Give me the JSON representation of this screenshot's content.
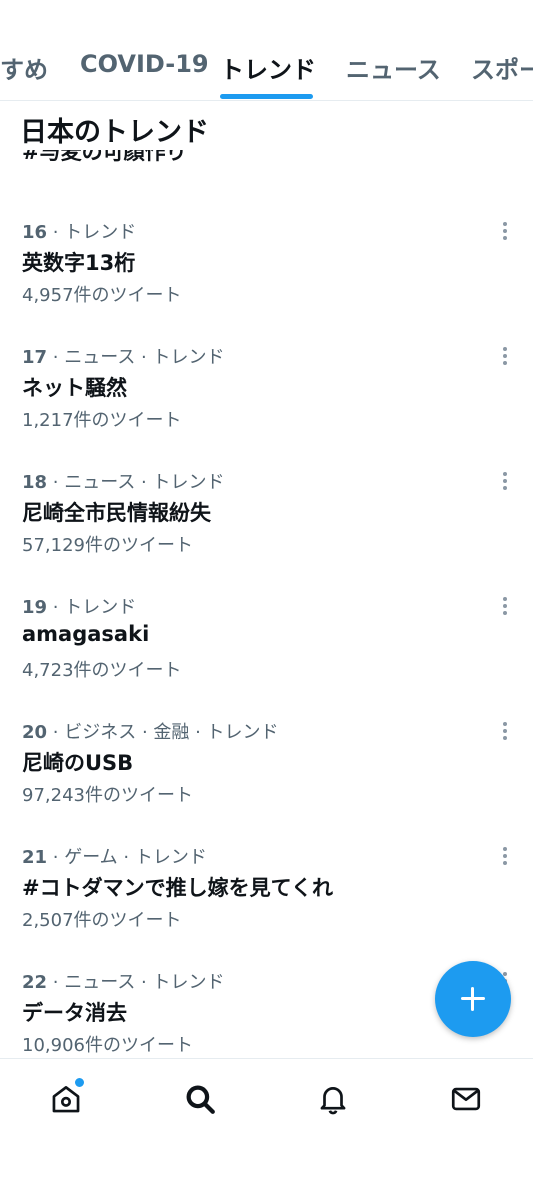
{
  "tabs": [
    {
      "label": "すめ"
    },
    {
      "label": "COVID-19"
    },
    {
      "label": "トレンド"
    },
    {
      "label": "ニュース"
    },
    {
      "label": "スポー"
    }
  ],
  "section_title": "日本のトレンド",
  "cut_item_name": "#与麦の可顔作り",
  "trends": [
    {
      "rank": "16",
      "category": " · トレンド",
      "name": "英数字13桁",
      "count": "4,957件のツイート"
    },
    {
      "rank": "17",
      "category": " · ニュース · トレンド",
      "name": "ネット騒然",
      "count": "1,217件のツイート"
    },
    {
      "rank": "18",
      "category": " · ニュース · トレンド",
      "name": "尼崎全市民情報紛失",
      "count": "57,129件のツイート"
    },
    {
      "rank": "19",
      "category": " · トレンド",
      "name": "amagasaki",
      "count": "4,723件のツイート"
    },
    {
      "rank": "20",
      "category": " · ビジネス · 金融 · トレンド",
      "name": "尼崎のUSB",
      "count": "97,243件のツイート"
    },
    {
      "rank": "21",
      "category": " · ゲーム · トレンド",
      "name": "#コトダマンで推し嫁を見てくれ",
      "count": "2,507件のツイート"
    },
    {
      "rank": "22",
      "category": " · ニュース · トレンド",
      "name": "データ消去",
      "count": "10,906件のツイート"
    }
  ],
  "icons": {
    "home": "home-icon",
    "search": "search-icon",
    "notifications": "bell-icon",
    "messages": "mail-icon",
    "compose": "plus-icon",
    "more": "more-vertical-icon"
  },
  "colors": {
    "accent": "#1d9bf0",
    "text_primary": "#0f1419",
    "text_secondary": "#536471"
  }
}
